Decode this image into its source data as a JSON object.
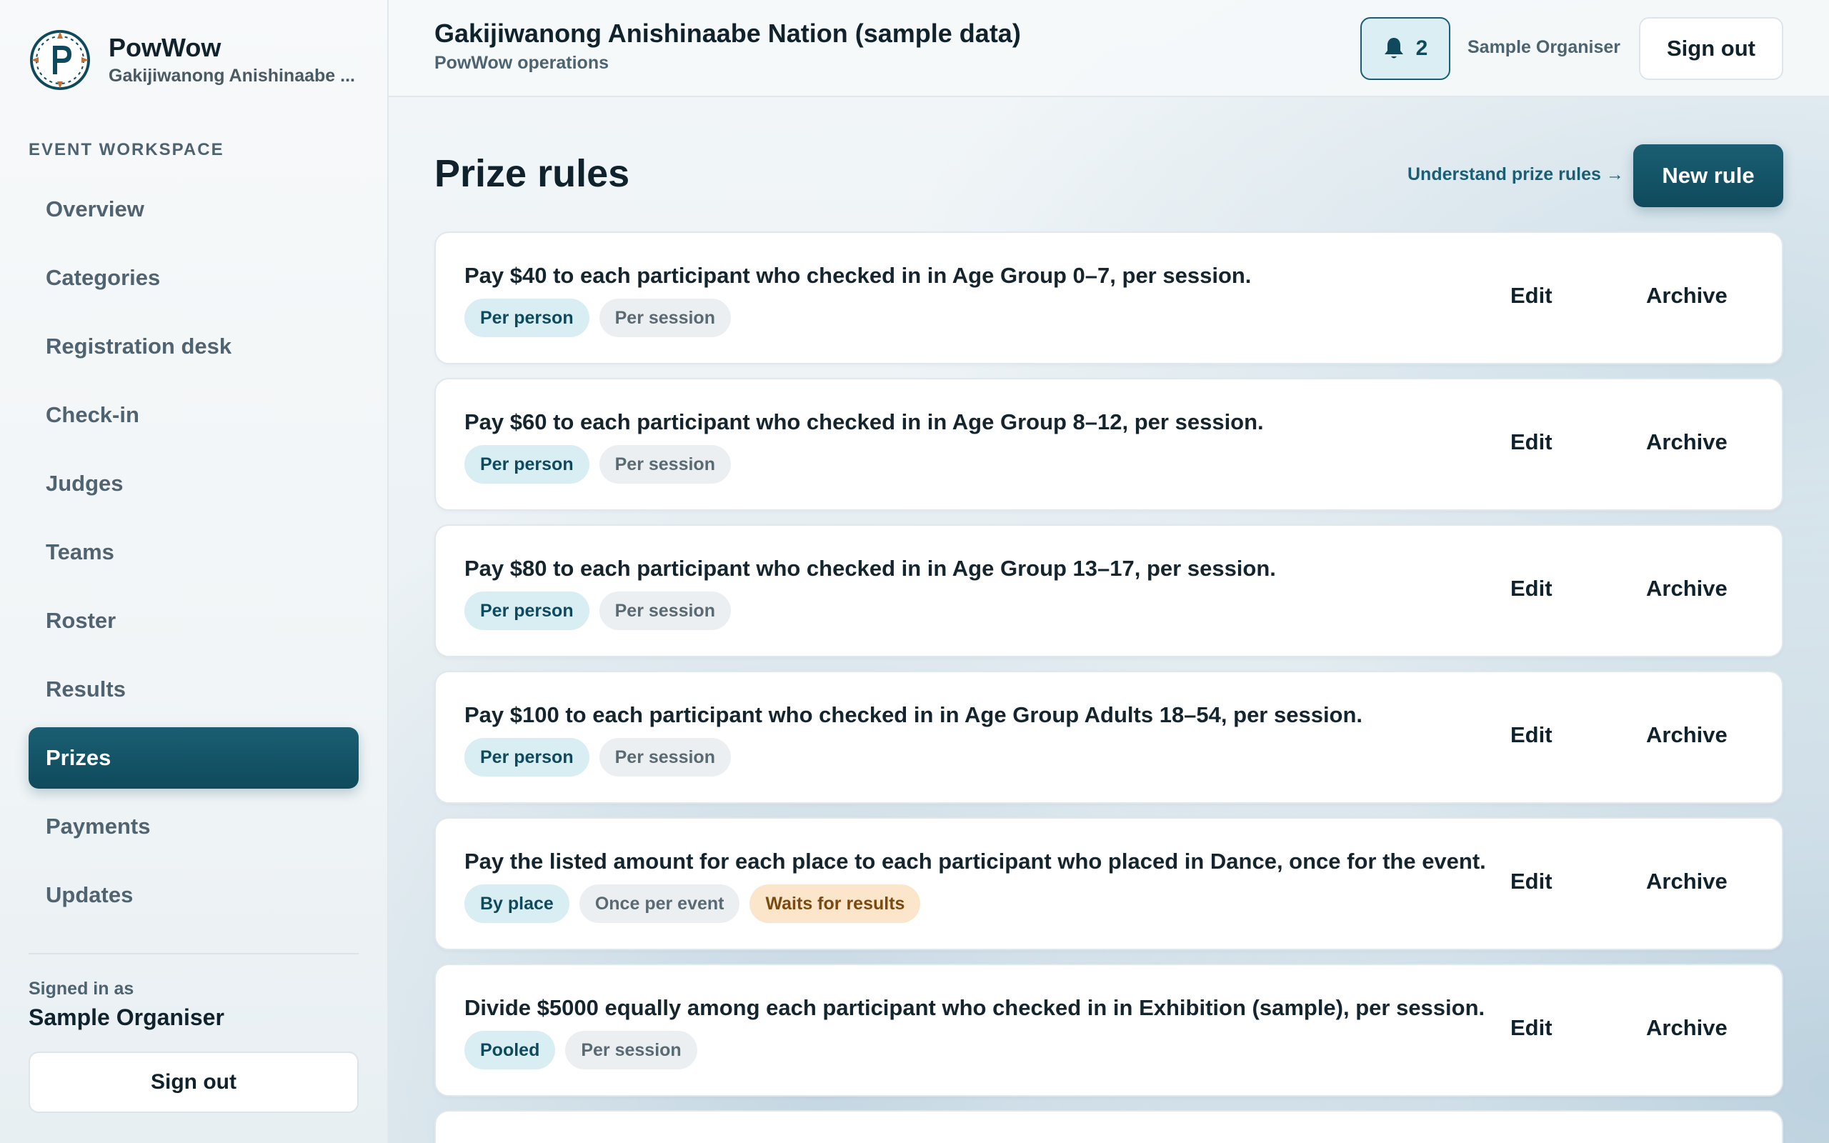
{
  "app": {
    "name": "PowWow",
    "org_short": "Gakijiwanong Anishinaabe ..."
  },
  "sidebar": {
    "section_label": "EVENT WORKSPACE",
    "items": [
      {
        "label": "Overview",
        "active": false
      },
      {
        "label": "Categories",
        "active": false
      },
      {
        "label": "Registration desk",
        "active": false
      },
      {
        "label": "Check-in",
        "active": false
      },
      {
        "label": "Judges",
        "active": false
      },
      {
        "label": "Teams",
        "active": false
      },
      {
        "label": "Roster",
        "active": false
      },
      {
        "label": "Results",
        "active": false
      },
      {
        "label": "Prizes",
        "active": true
      },
      {
        "label": "Payments",
        "active": false
      },
      {
        "label": "Updates",
        "active": false
      }
    ],
    "signed_in_label": "Signed in as",
    "signed_in_name": "Sample Organiser",
    "sign_out_label": "Sign out"
  },
  "header": {
    "org_title": "Gakijiwanong Anishinaabe Nation (sample data)",
    "subtitle": "PowWow operations",
    "notification_icon": "bell-icon",
    "notification_count": "2",
    "user_name": "Sample Organiser",
    "sign_out_label": "Sign out"
  },
  "page": {
    "title": "Prize rules",
    "help_link": "Understand prize rules →",
    "new_rule_label": "New rule"
  },
  "rules": [
    {
      "text": "Pay $40 to each participant who checked in in Age Group 0–7, per session.",
      "tags": [
        {
          "label": "Per person",
          "kind": "primary"
        },
        {
          "label": "Per session",
          "kind": "neutral"
        }
      ]
    },
    {
      "text": "Pay $60 to each participant who checked in in Age Group 8–12, per session.",
      "tags": [
        {
          "label": "Per person",
          "kind": "primary"
        },
        {
          "label": "Per session",
          "kind": "neutral"
        }
      ]
    },
    {
      "text": "Pay $80 to each participant who checked in in Age Group 13–17, per session.",
      "tags": [
        {
          "label": "Per person",
          "kind": "primary"
        },
        {
          "label": "Per session",
          "kind": "neutral"
        }
      ]
    },
    {
      "text": "Pay $100 to each participant who checked in in Age Group Adults 18–54, per session.",
      "tags": [
        {
          "label": "Per person",
          "kind": "primary"
        },
        {
          "label": "Per session",
          "kind": "neutral"
        }
      ]
    },
    {
      "text": "Pay the listed amount for each place to each participant who placed in Dance, once for the event.",
      "tags": [
        {
          "label": "By place",
          "kind": "primary"
        },
        {
          "label": "Once per event",
          "kind": "neutral"
        },
        {
          "label": "Waits for results",
          "kind": "warn"
        }
      ]
    },
    {
      "text": "Divide $5000 equally among each participant who checked in in Exhibition (sample), per session.",
      "tags": [
        {
          "label": "Pooled",
          "kind": "primary"
        },
        {
          "label": "Per session",
          "kind": "neutral"
        }
      ]
    }
  ],
  "rule_actions": {
    "edit_label": "Edit",
    "archive_label": "Archive"
  },
  "colors": {
    "accent": "#0f4a5c",
    "accent_light": "#d9eef3",
    "warn_bg": "#fbe6cc"
  }
}
